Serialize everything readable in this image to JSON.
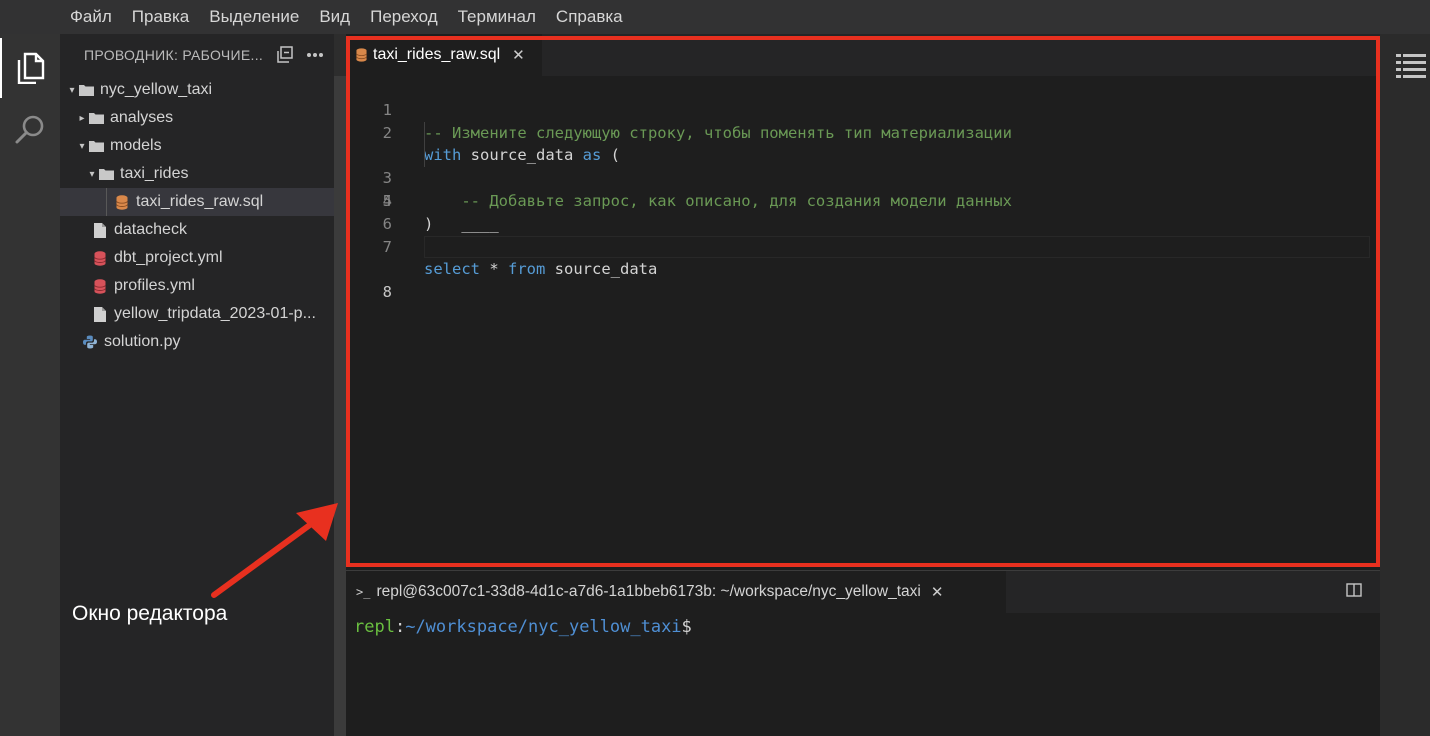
{
  "menu": [
    "Файл",
    "Правка",
    "Выделение",
    "Вид",
    "Переход",
    "Терминал",
    "Справка"
  ],
  "activity_bar": {
    "items": [
      {
        "icon": "files-icon",
        "active": true
      },
      {
        "icon": "search-icon",
        "active": false
      }
    ]
  },
  "explorer": {
    "title": "ПРОВОДНИК: РАБОЧИЕ...",
    "header_icons": [
      "collapse-all-icon",
      "more-actions-icon"
    ],
    "tree": [
      {
        "label": "nyc_yellow_taxi",
        "type": "folder",
        "expanded": true
      },
      {
        "label": "analyses",
        "type": "folder",
        "expanded": false
      },
      {
        "label": "models",
        "type": "folder",
        "expanded": true
      },
      {
        "label": "taxi_rides",
        "type": "folder",
        "expanded": true
      },
      {
        "label": "taxi_rides_raw.sql",
        "type": "sql-file",
        "selected": true
      },
      {
        "label": "datacheck",
        "type": "file"
      },
      {
        "label": "dbt_project.yml",
        "type": "yml-file"
      },
      {
        "label": "profiles.yml",
        "type": "yml-file"
      },
      {
        "label": "yellow_tripdata_2023-01-p...",
        "type": "file"
      },
      {
        "label": "solution.py",
        "type": "py-file"
      }
    ]
  },
  "editor": {
    "tab_label": "taxi_rides_raw.sql",
    "active_line": 8,
    "lines": [
      {
        "num": "1",
        "comment": "-- Измените следующую строку, чтобы поменять тип материализации"
      },
      {
        "num": "2",
        "kw1": "with",
        "rest1": " source_data ",
        "kw2": "as",
        "rest2": " ("
      },
      {
        "num": "3",
        "comment": "    -- Добавьте запрос, как описано, для создания модели данных"
      },
      {
        "num": "4",
        "text": "    ____"
      },
      {
        "num": "5",
        "text": ")"
      },
      {
        "num": "6",
        "text": ""
      },
      {
        "num": "7",
        "kw1": "select",
        "rest1": " * ",
        "kw2": "from",
        "rest2": " source_data"
      },
      {
        "num": "8",
        "text": ""
      }
    ]
  },
  "terminal": {
    "tab_label": "repl@63c007c1-33d8-4d1c-a7d6-1a1bbeb6173b: ~/workspace/nyc_yellow_taxi",
    "prompt_user": "repl",
    "prompt_sep": ":",
    "prompt_path": "~/workspace/nyc_yellow_taxi",
    "prompt_end": "$"
  },
  "annotation": {
    "label": "Окно редактора",
    "color": "#e8301f"
  },
  "colors": {
    "comment": "#6a9955",
    "keyword": "#569cd6",
    "terminal_user": "#6abf40",
    "terminal_path": "#4f8fd4",
    "highlight": "#e8301f"
  }
}
